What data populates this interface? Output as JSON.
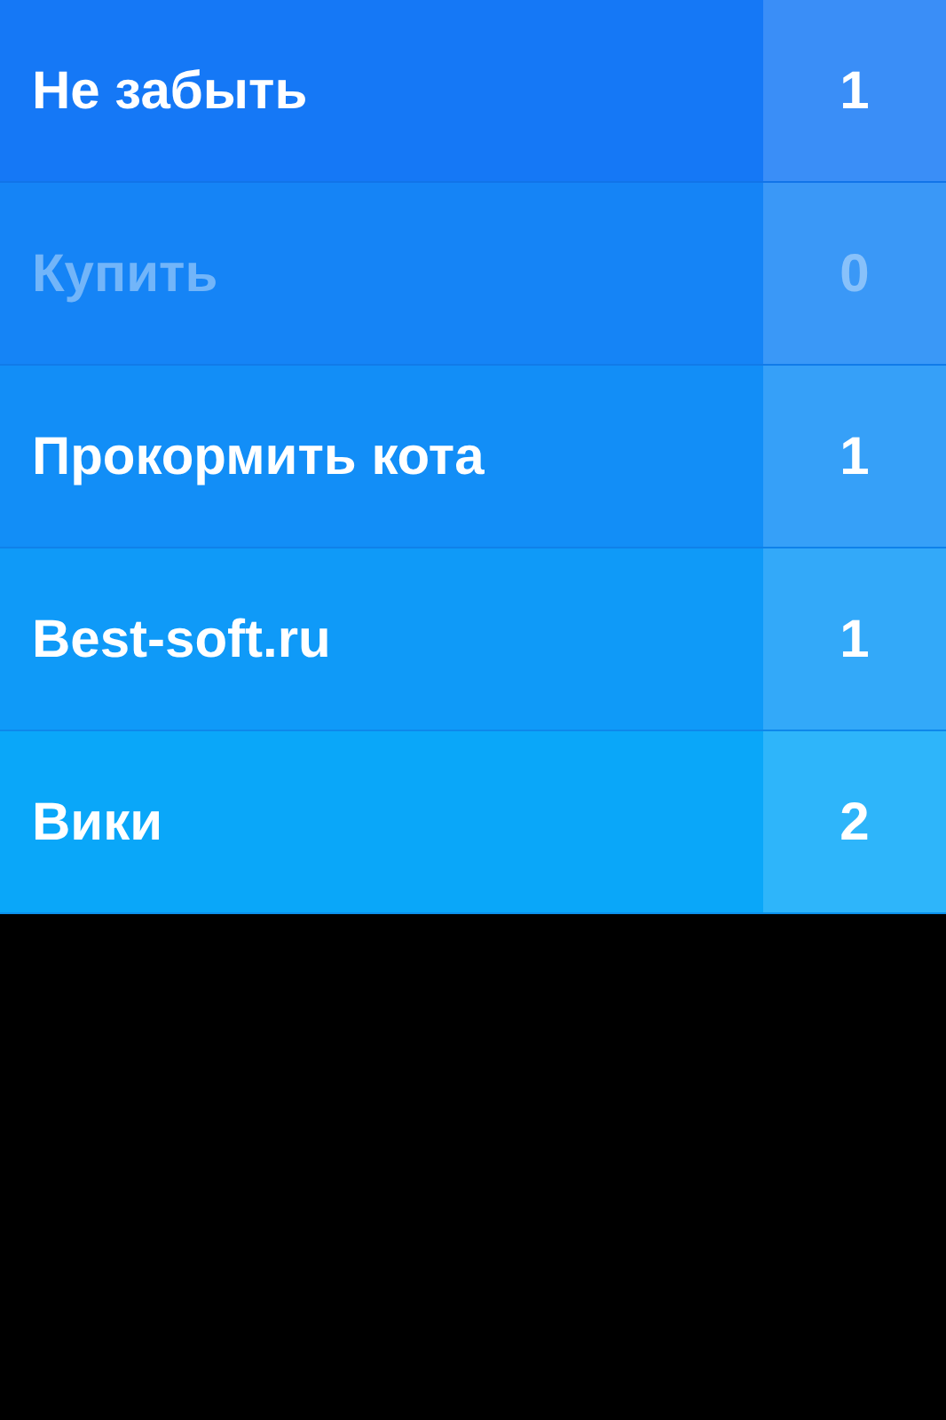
{
  "lists": [
    {
      "name": "Не забыть",
      "count": "1",
      "disabled": false
    },
    {
      "name": "Купить",
      "count": "0",
      "disabled": true
    },
    {
      "name": "Прокормить кота",
      "count": "1",
      "disabled": false
    },
    {
      "name": "Best-soft.ru",
      "count": "1",
      "disabled": false
    },
    {
      "name": "Вики",
      "count": "2",
      "disabled": false
    }
  ]
}
